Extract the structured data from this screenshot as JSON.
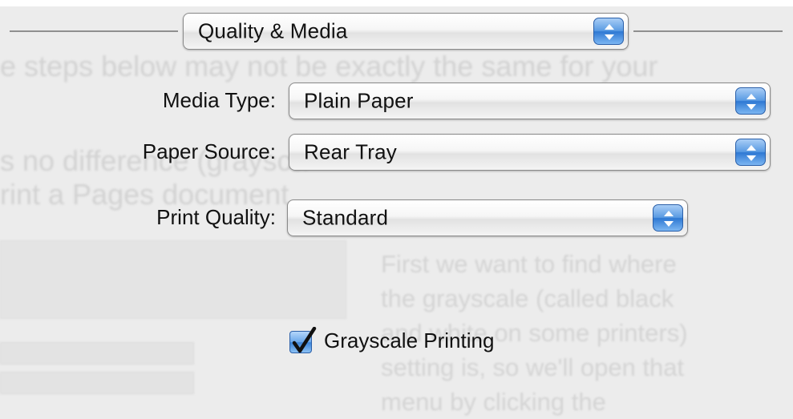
{
  "background_text": {
    "line1": "e steps below may not be exactly the same for your",
    "line2": "s no difference (graysca",
    "line3": "rint a Pages document.",
    "column": [
      "First we want to find where",
      "the grayscale (called black",
      "and white on some printers)",
      "setting is, so we'll open that",
      "menu by clicking the"
    ]
  },
  "section_popup": {
    "value": "Quality & Media"
  },
  "media_type": {
    "label": "Media Type:",
    "value": "Plain Paper"
  },
  "paper_source": {
    "label": "Paper Source:",
    "value": "Rear Tray"
  },
  "print_quality": {
    "label": "Print Quality:",
    "value": "Standard"
  },
  "grayscale": {
    "label": "Grayscale Printing",
    "checked": true
  },
  "colors": {
    "accent": "#3a82d8",
    "panel": "#ececec"
  }
}
